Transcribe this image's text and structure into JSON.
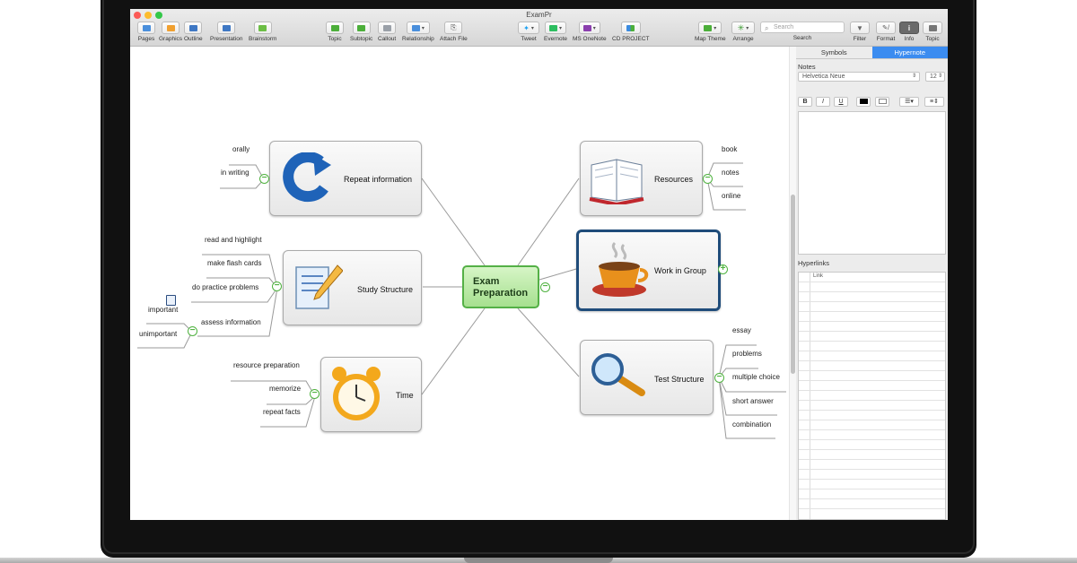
{
  "window": {
    "title": "ExamPr"
  },
  "toolbar": {
    "left": [
      {
        "label": "Pages",
        "icon": "pages-icon"
      },
      {
        "label": "Graphics",
        "icon": "graphics-icon"
      },
      {
        "label": "Outline",
        "icon": "outline-icon"
      },
      {
        "label": "Presentation",
        "icon": "presentation-icon"
      },
      {
        "label": "Brainstorm",
        "icon": "brainstorm-icon"
      }
    ],
    "insert": [
      {
        "label": "Topic",
        "icon": "topic-icon"
      },
      {
        "label": "Subtopic",
        "icon": "subtopic-icon"
      },
      {
        "label": "Callout",
        "icon": "callout-icon"
      },
      {
        "label": "Relationship",
        "icon": "relationship-icon"
      },
      {
        "label": "Attach File",
        "icon": "attach-file-icon"
      }
    ],
    "share": [
      {
        "label": "Tweet",
        "icon": "twitter-icon"
      },
      {
        "label": "Evernote",
        "icon": "evernote-icon"
      },
      {
        "label": "MS OneNote",
        "icon": "onenote-icon"
      },
      {
        "label": "CD PROJECT",
        "icon": "cd-project-icon"
      }
    ],
    "layout": [
      {
        "label": "Map Theme",
        "icon": "map-theme-icon"
      },
      {
        "label": "Arrange",
        "icon": "arrange-icon"
      }
    ],
    "search": {
      "placeholder": "Search",
      "label": "Search"
    },
    "right": [
      {
        "label": "Filter",
        "icon": "filter-icon"
      },
      {
        "label": "Format",
        "icon": "format-icon"
      },
      {
        "label": "Info",
        "icon": "info-icon"
      },
      {
        "label": "Topic",
        "icon": "topic-panel-icon"
      }
    ]
  },
  "map": {
    "central": "Exam Preparation",
    "topics": [
      {
        "id": "repeat",
        "label": "Repeat information",
        "icon": "repeat-arrow-icon",
        "leaves": [
          "orally",
          "in writing"
        ]
      },
      {
        "id": "study",
        "label": "Study Structure",
        "icon": "notepad-pencil-icon",
        "leaves": [
          "read and highlight",
          "make flash cards",
          "do practice  problems",
          "assess information"
        ],
        "subleaves": [
          "important",
          "unimportant"
        ]
      },
      {
        "id": "time",
        "label": "Time",
        "icon": "alarm-clock-icon",
        "leaves": [
          "resource preparation",
          "memorize",
          "repeat facts"
        ]
      },
      {
        "id": "resources",
        "label": "Resources",
        "icon": "open-book-icon",
        "leaves": [
          "book",
          "notes",
          "online"
        ]
      },
      {
        "id": "group",
        "label": "Work in Group",
        "icon": "coffee-cup-icon",
        "leaves": []
      },
      {
        "id": "test",
        "label": "Test Structure",
        "icon": "magnifier-icon",
        "leaves": [
          "essay",
          "problems",
          "multiple choice",
          "short answer",
          "combination"
        ]
      }
    ]
  },
  "panel": {
    "tabs": [
      "Symbols",
      "Hypernote"
    ],
    "active_tab": "Hypernote",
    "notes_label": "Notes",
    "font": "Helvetica Neue",
    "font_size": "12",
    "format_buttons": [
      "B",
      "I",
      "U"
    ],
    "hyperlinks_label": "Hyperlinks",
    "link_column": "Link"
  },
  "colors": {
    "accent": "#3b8cf0",
    "central_fill": "#a6e08f",
    "toggle": "#4fb23f",
    "selection": "#1f4c7a"
  }
}
